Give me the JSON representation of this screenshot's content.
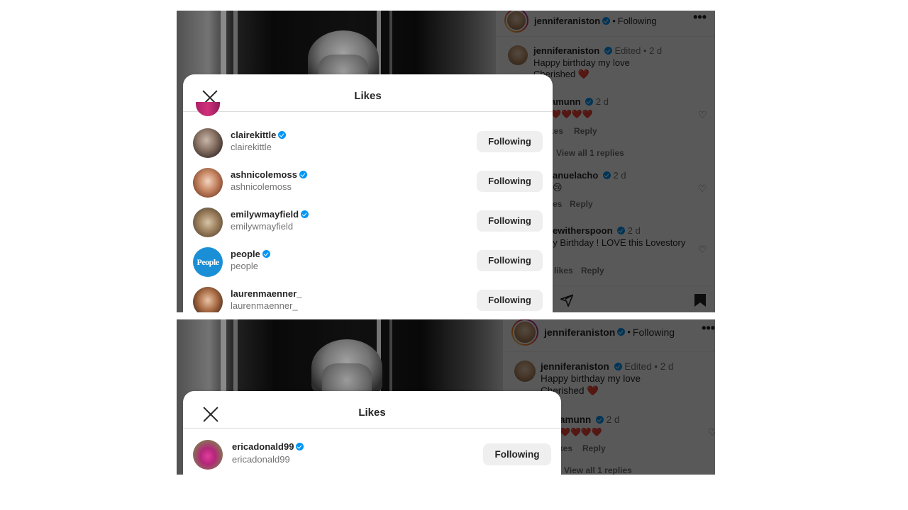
{
  "post": {
    "author": "jenniferaniston",
    "follow_status": "Following",
    "more": "•••"
  },
  "comments": [
    {
      "user": "jenniferaniston",
      "meta": "Edited • 2 d",
      "text_line1": "Happy birthday my love",
      "text_line2": "Cherished ❤️"
    },
    {
      "user_partial": "amunn",
      "meta": "2 d",
      "text": "❤️❤️❤️❤️",
      "sub_likes": "kes",
      "sub_reply": "Reply",
      "view_replies": "View all 1 replies"
    },
    {
      "user_partial": "anuelacho",
      "meta": "2 d",
      "text": "😢",
      "sub_likes": "es",
      "sub_reply": "Reply"
    },
    {
      "user_partial": "ewitherspoon",
      "meta": "2 d",
      "text": "py Birthday ! LOVE this Lovestory",
      "sub_likes": "likes",
      "sub_reply": "Reply"
    }
  ],
  "modal": {
    "title": "Likes"
  },
  "likes_top": [
    {
      "username": "clairekittle",
      "name": "clairekittle",
      "button": "Following"
    },
    {
      "username": "ashnicolemoss",
      "name": "ashnicolemoss",
      "button": "Following"
    },
    {
      "username": "emilywmayfield",
      "name": "emilywmayfield",
      "button": "Following"
    },
    {
      "username": "people",
      "name": "people",
      "button": "Following",
      "avatar_text": "People"
    },
    {
      "username": "laurenmaenner_",
      "name": "laurenmaenner_",
      "button": "Following"
    }
  ],
  "likes_bottom": [
    {
      "username": "ericadonald99",
      "name": "ericadonald99",
      "button": "Following"
    }
  ],
  "colors": {
    "verified": "#0095f6",
    "button_bg": "#efefef",
    "heart": "#ed4956"
  }
}
